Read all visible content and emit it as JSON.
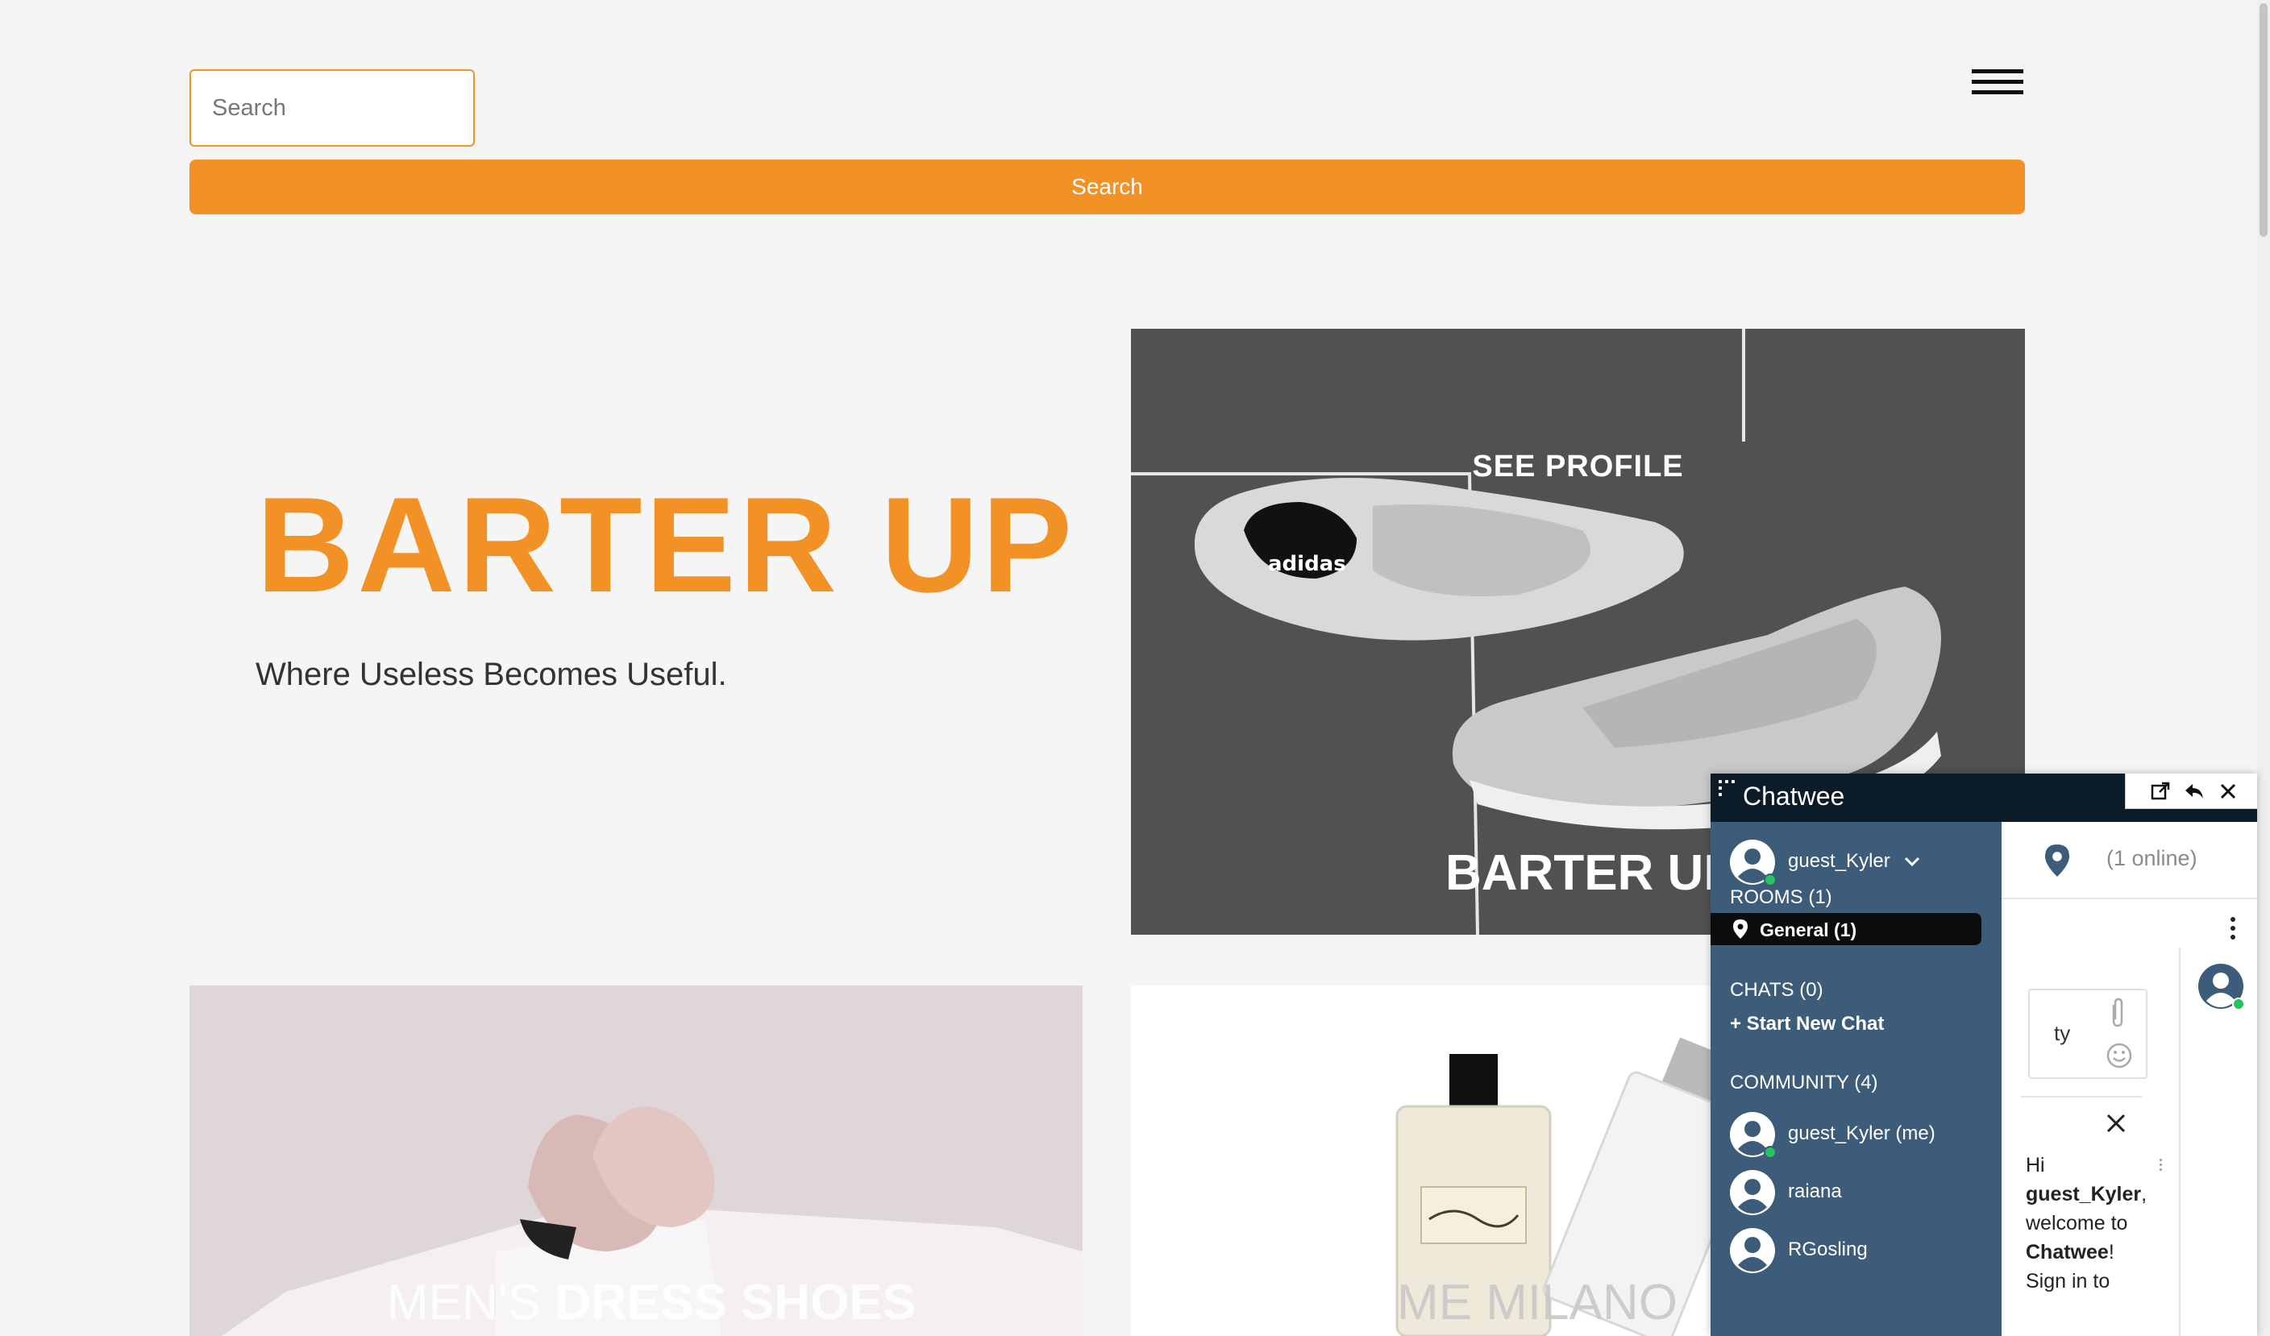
{
  "header": {
    "search_placeholder": "Search",
    "search_button_label": "Search",
    "menu_icon": "hamburger-menu-icon"
  },
  "hero": {
    "title": "BARTER UP",
    "tagline": "Where Useless Becomes Useful."
  },
  "tiles": [
    {
      "top_label": "SEE PROFILE",
      "bottom_label": "BARTER UP",
      "image": "sneakers-photo"
    },
    {
      "label_light": "MEN'S ",
      "label_bold": "DRESS SHOES",
      "image": "dress-shoes-photo"
    },
    {
      "label": "ME MILANO",
      "image": "perfume-photo"
    }
  ],
  "chat": {
    "title": "Chatwee",
    "user": {
      "name": "guest_Kyler"
    },
    "rooms_heading": "ROOMS (1)",
    "rooms": [
      {
        "label": "General (1)"
      }
    ],
    "chats_heading": "CHATS (0)",
    "start_chat_label": "+ Start New Chat",
    "community_heading": "COMMUNITY (4)",
    "community": [
      {
        "name": "guest_Kyler (me)",
        "online": true
      },
      {
        "name": "raiana",
        "online": false
      },
      {
        "name": "RGosling",
        "online": false
      }
    ],
    "online_count": "(1 online)",
    "message_draft": "ty",
    "welcome": {
      "hi": "Hi",
      "name": "guest_Kyler",
      "line2": "welcome to",
      "brand": "Chatwee",
      "line4": "Sign in to"
    },
    "colors": {
      "sidebar": "#3d5c7a",
      "titlebar": "#0c1b28",
      "online": "#22c55e"
    }
  },
  "colors": {
    "accent": "#f29126",
    "background": "#f6f5f5"
  }
}
